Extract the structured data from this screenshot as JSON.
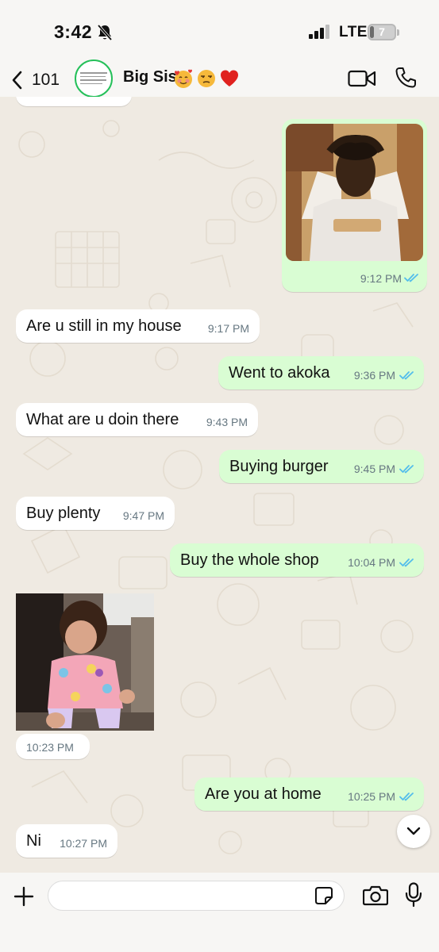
{
  "status_bar": {
    "time": "3:42",
    "network": "LTE",
    "battery": "7"
  },
  "header": {
    "back_count": "101",
    "contact_name": "Big Sis",
    "name_emojis": [
      "smiling-face-with-hearts",
      "unamused-face",
      "red-heart"
    ]
  },
  "messages": [
    {
      "dir": "out",
      "type": "image",
      "image_desc": "boy with hands on head",
      "time": "9:12 PM",
      "read": true
    },
    {
      "dir": "in",
      "type": "text",
      "text": "Are u still in my house",
      "time": "9:17 PM"
    },
    {
      "dir": "out",
      "type": "text",
      "text": "Went to akoka",
      "time": "9:36 PM",
      "read": true
    },
    {
      "dir": "in",
      "type": "text",
      "text": "What are u doin there",
      "time": "9:43 PM"
    },
    {
      "dir": "out",
      "type": "text",
      "text": "Buying burger",
      "time": "9:45 PM",
      "read": true
    },
    {
      "dir": "in",
      "type": "text",
      "text": "Buy plenty",
      "time": "9:47 PM"
    },
    {
      "dir": "out",
      "type": "text",
      "text": "Buy the whole shop",
      "time": "10:04 PM",
      "read": true
    },
    {
      "dir": "in",
      "type": "image",
      "image_desc": "toddler dancing",
      "time": "10:23 PM"
    },
    {
      "dir": "out",
      "type": "text",
      "text": "Are you at home",
      "time": "10:25 PM",
      "read": true
    },
    {
      "dir": "in",
      "type": "text",
      "text": "Ni",
      "time": "10:27 PM"
    }
  ],
  "input": {
    "placeholder": ""
  },
  "colors": {
    "chat_bg": "#efeae2",
    "outgoing_bubble": "#d9fdd3",
    "incoming_bubble": "#ffffff",
    "read_tick": "#53bdeb",
    "avatar_ring": "#25c05a"
  }
}
